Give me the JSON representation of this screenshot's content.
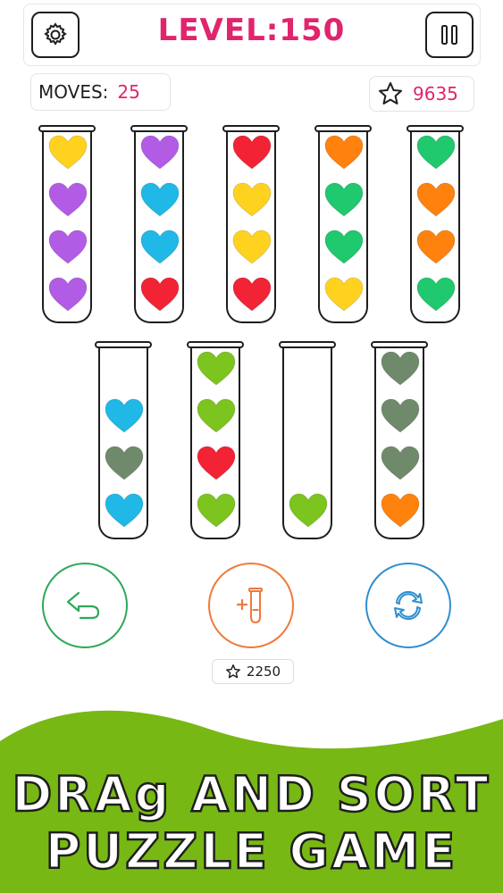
{
  "header": {
    "level_text": "LEVEL:150"
  },
  "stats": {
    "moves_label": "MOVES:",
    "moves_value": "25",
    "stars_value": "9635"
  },
  "colors": {
    "yellow": "#ffd21f",
    "purple": "#b25ce6",
    "red": "#f22335",
    "orange": "#ff820f",
    "green": "#20c86e",
    "blue": "#20b8e6",
    "lime": "#7cc41e",
    "olive": "#6f8a6a",
    "accent": "#e0246e",
    "undo": "#2fa85a",
    "add": "#ef7a3a",
    "restart": "#2f8fd0"
  },
  "tubes": [
    {
      "name": "tube-1",
      "hearts": [
        "yellow",
        "purple",
        "purple",
        "purple"
      ]
    },
    {
      "name": "tube-2",
      "hearts": [
        "purple",
        "blue",
        "blue",
        "red"
      ]
    },
    {
      "name": "tube-3",
      "hearts": [
        "red",
        "yellow",
        "yellow",
        "red"
      ]
    },
    {
      "name": "tube-4",
      "hearts": [
        "orange",
        "green",
        "green",
        "yellow"
      ]
    },
    {
      "name": "tube-5",
      "hearts": [
        "green",
        "orange",
        "orange",
        "green"
      ]
    },
    {
      "name": "tube-6",
      "hearts": [
        "blue",
        "olive",
        "blue"
      ]
    },
    {
      "name": "tube-7",
      "hearts": [
        "lime",
        "lime",
        "red",
        "lime"
      ]
    },
    {
      "name": "tube-8",
      "hearts": [
        "lime"
      ]
    },
    {
      "name": "tube-9",
      "hearts": [
        "olive",
        "olive",
        "olive",
        "orange"
      ]
    }
  ],
  "controls": {
    "add_tube_cost": "2250"
  },
  "promo": {
    "line1": "DRAg AND SORT",
    "line2": "PUZZLE GAME",
    "bg_color": "#77b814"
  }
}
